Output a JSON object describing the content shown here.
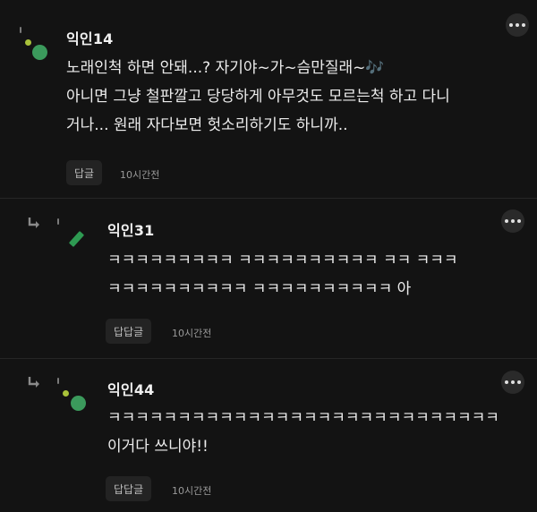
{
  "comments": [
    {
      "nickname": "익인14",
      "lines": [
        "노래인척 하면 안돼...? 자기야~가~슴만질래~🎶",
        "아니면 그냥 철판깔고 당당하게 아무것도 모르는척 하고 다니",
        "거나... 원래 자다보면 헛소리하기도 하니까.."
      ],
      "reply_label": "답글",
      "time": "10시간전"
    },
    {
      "nickname": "익인31",
      "lines": [
        "ㅋㅋㅋㅋㅋㅋㅋㅋㅋ ㅋㅋㅋㅋㅋㅋㅋㅋㅋㅋ ㅋㅋ ㅋㅋㅋ",
        "ㅋㅋㅋㅋㅋㅋㅋㅋㅋㅋ ㅋㅋㅋㅋㅋㅋㅋㅋㅋㅋ 아"
      ],
      "reply_label": "답답글",
      "time": "10시간전"
    },
    {
      "nickname": "익인44",
      "lines": [
        "ㅋㅋㅋㅋㅋㅋㅋㅋㅋㅋㅋㅋㅋㅋㅋㅋㅋㅋㅋㅋㅋㅋㅋㅋㅋㅋㅋㅋ",
        "이거다 쓰니야!!"
      ],
      "reply_label": "답답글",
      "time": "10시간전"
    }
  ],
  "icons": {
    "more": "more-icon",
    "reply_arrow": "reply-arrow-icon",
    "avatar": "avatar-icon"
  },
  "colors": {
    "background": "#131313",
    "avatar_green": "#3b9a5c",
    "button_bg": "#232323"
  }
}
